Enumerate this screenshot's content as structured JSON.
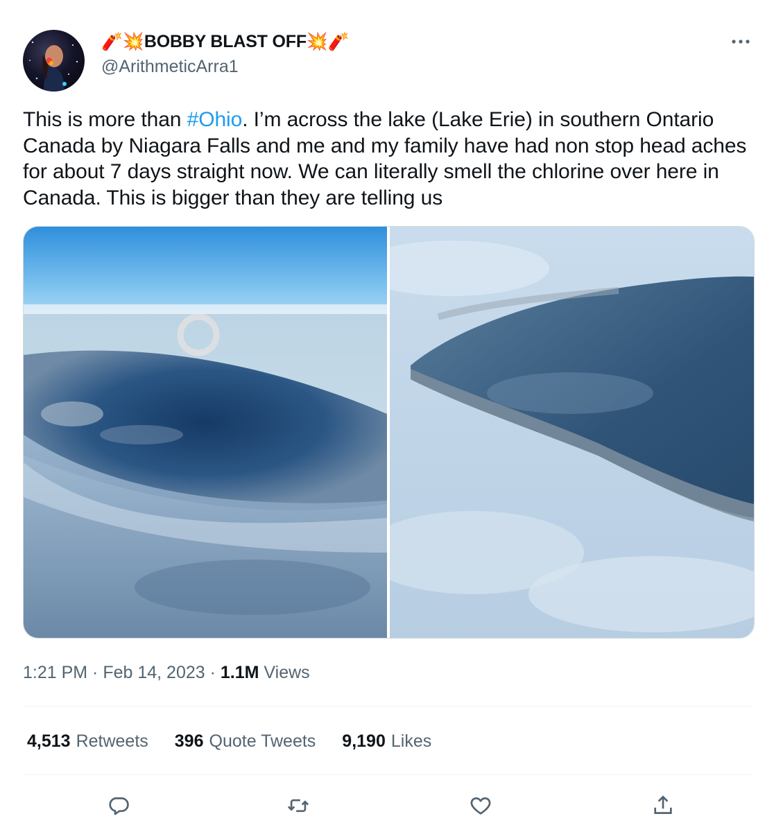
{
  "author": {
    "display_name": "🧨💥BOBBY BLAST OFF💥🧨",
    "handle": "@ArithmeticArra1"
  },
  "tweet": {
    "text_before": "This is more than ",
    "hashtag": "#Ohio",
    "text_after": ". I’m across the lake (Lake Erie) in southern Ontario Canada by Niagara Falls and me and my family have had non stop head aches for about 7 days straight now. We can literally smell the chlorine over here in Canada. This is  bigger than they are telling us"
  },
  "meta": {
    "time": "1:21 PM",
    "separator": " · ",
    "date": "Feb 14, 2023",
    "views_count": "1.1M",
    "views_label": " Views"
  },
  "stats": {
    "retweets": {
      "count": "4,513",
      "label": "Retweets"
    },
    "quotes": {
      "count": "396",
      "label": "Quote Tweets"
    },
    "likes": {
      "count": "9,190",
      "label": "Likes"
    }
  },
  "icons": {
    "more": "more-horizontal-icon",
    "reply": "reply-icon",
    "retweet": "retweet-icon",
    "like": "heart-icon",
    "share": "share-icon"
  },
  "colors": {
    "text": "#0f1419",
    "secondary": "#536471",
    "accent": "#1d9bf0",
    "border": "#cfd9de",
    "divider": "#eff3f4"
  }
}
